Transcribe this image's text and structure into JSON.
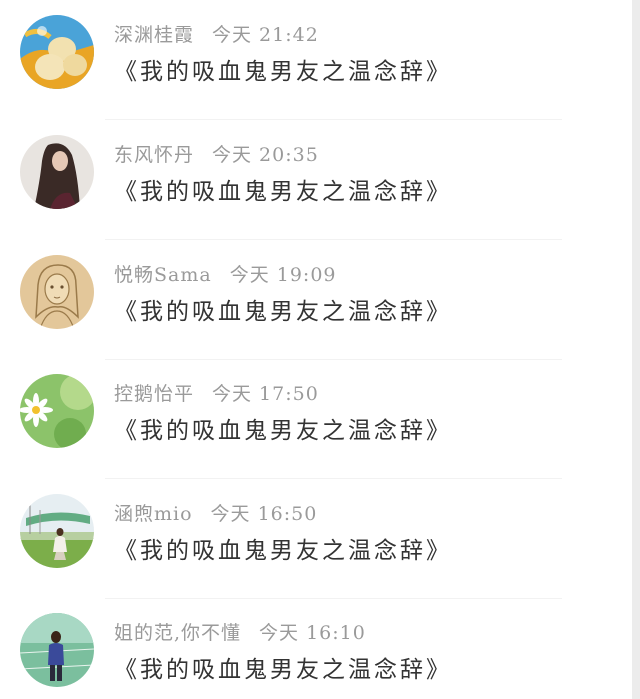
{
  "messages": [
    {
      "user": "深渊桂霞",
      "time": "今天 21:42",
      "text": "《我的吸血鬼男友之温念辞》",
      "avatar_icon": "eggs-photo-avatar"
    },
    {
      "user": "东风怀丹",
      "time": "今天 20:35",
      "text": "《我的吸血鬼男友之温念辞》",
      "avatar_icon": "long-hair-girl-avatar"
    },
    {
      "user": "悦畅Sama",
      "time": "今天 19:09",
      "text": "《我的吸血鬼男友之温念辞》",
      "avatar_icon": "sketch-girl-avatar"
    },
    {
      "user": "控鹅怡平",
      "time": "今天 17:50",
      "text": "《我的吸血鬼男友之温念辞》",
      "avatar_icon": "daisy-flower-avatar"
    },
    {
      "user": "涵煦mio",
      "time": "今天 16:50",
      "text": "《我的吸血鬼男友之温念辞》",
      "avatar_icon": "field-girl-avatar"
    },
    {
      "user": "姐的范,你不懂",
      "time": "今天 16:10",
      "text": "《我的吸血鬼男友之温念辞》",
      "avatar_icon": "blue-jacket-girl-avatar"
    }
  ],
  "colors": {
    "meta_text": "#9a9a9a",
    "message_text": "#333333",
    "background": "#ffffff"
  }
}
